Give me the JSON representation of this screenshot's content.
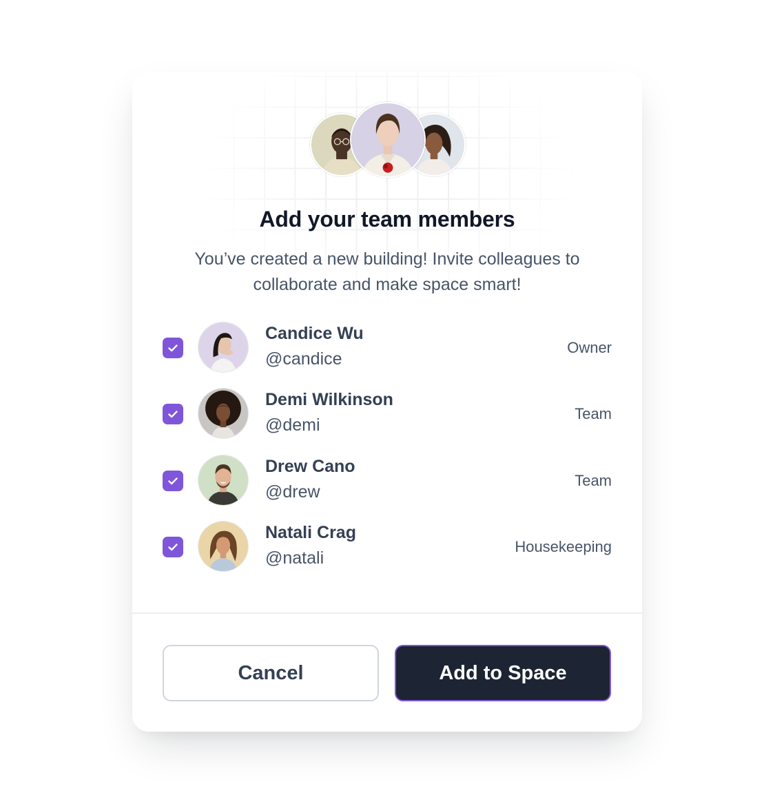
{
  "modal": {
    "title": "Add your team members",
    "subtitle": "You’ve created a new building! Invite colleagues to collaborate and make space smart!"
  },
  "members": [
    {
      "name": "Candice Wu",
      "handle": "@candice",
      "role": "Owner",
      "checked": true
    },
    {
      "name": "Demi Wilkinson",
      "handle": "@demi",
      "role": "Team",
      "checked": true
    },
    {
      "name": "Drew Cano",
      "handle": "@drew",
      "role": "Team",
      "checked": true
    },
    {
      "name": "Natali Crag",
      "handle": "@natali",
      "role": "Housekeeping",
      "checked": true
    }
  ],
  "actions": {
    "cancel_label": "Cancel",
    "confirm_label": "Add to Space"
  },
  "colors": {
    "accent": "#7f56d9",
    "primary_button": "#1d2433",
    "heading": "#101828",
    "body_text": "#475467"
  },
  "icons": {
    "checkbox": "check-icon"
  }
}
